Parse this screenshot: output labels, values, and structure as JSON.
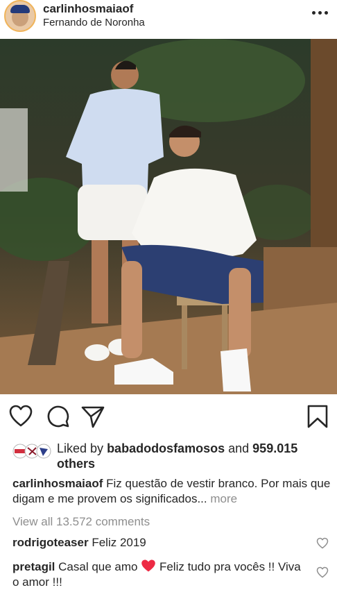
{
  "post": {
    "username": "carlinhosmaiaof",
    "location": "Fernando de Noronha"
  },
  "likes": {
    "prefix": "Liked by",
    "liker": "babadodosfamosos",
    "connector": "and",
    "count": "959.015",
    "suffix": "others"
  },
  "caption": {
    "username": "carlinhosmaiaof",
    "text": "Fiz questão de vestir branco. Por mais que digam e me provem os significados...",
    "more": "more"
  },
  "view_comments": "View all 13.572 comments",
  "comments": [
    {
      "username": "rodrigoteaser",
      "text": "Feliz 2019"
    },
    {
      "username": "pretagil",
      "text_before": "Casal que amo",
      "text_after": "Feliz tudo pra vocês !! Viva o amor !!!"
    }
  ],
  "icons": [
    "more-options-icon",
    "heart-icon",
    "comment-icon",
    "share-icon",
    "bookmark-icon",
    "red-heart-emoji",
    "comment-like-icon"
  ],
  "colors": {
    "text": "#262626",
    "muted": "#8e8e8e",
    "heart_red": "#ed2a44"
  }
}
